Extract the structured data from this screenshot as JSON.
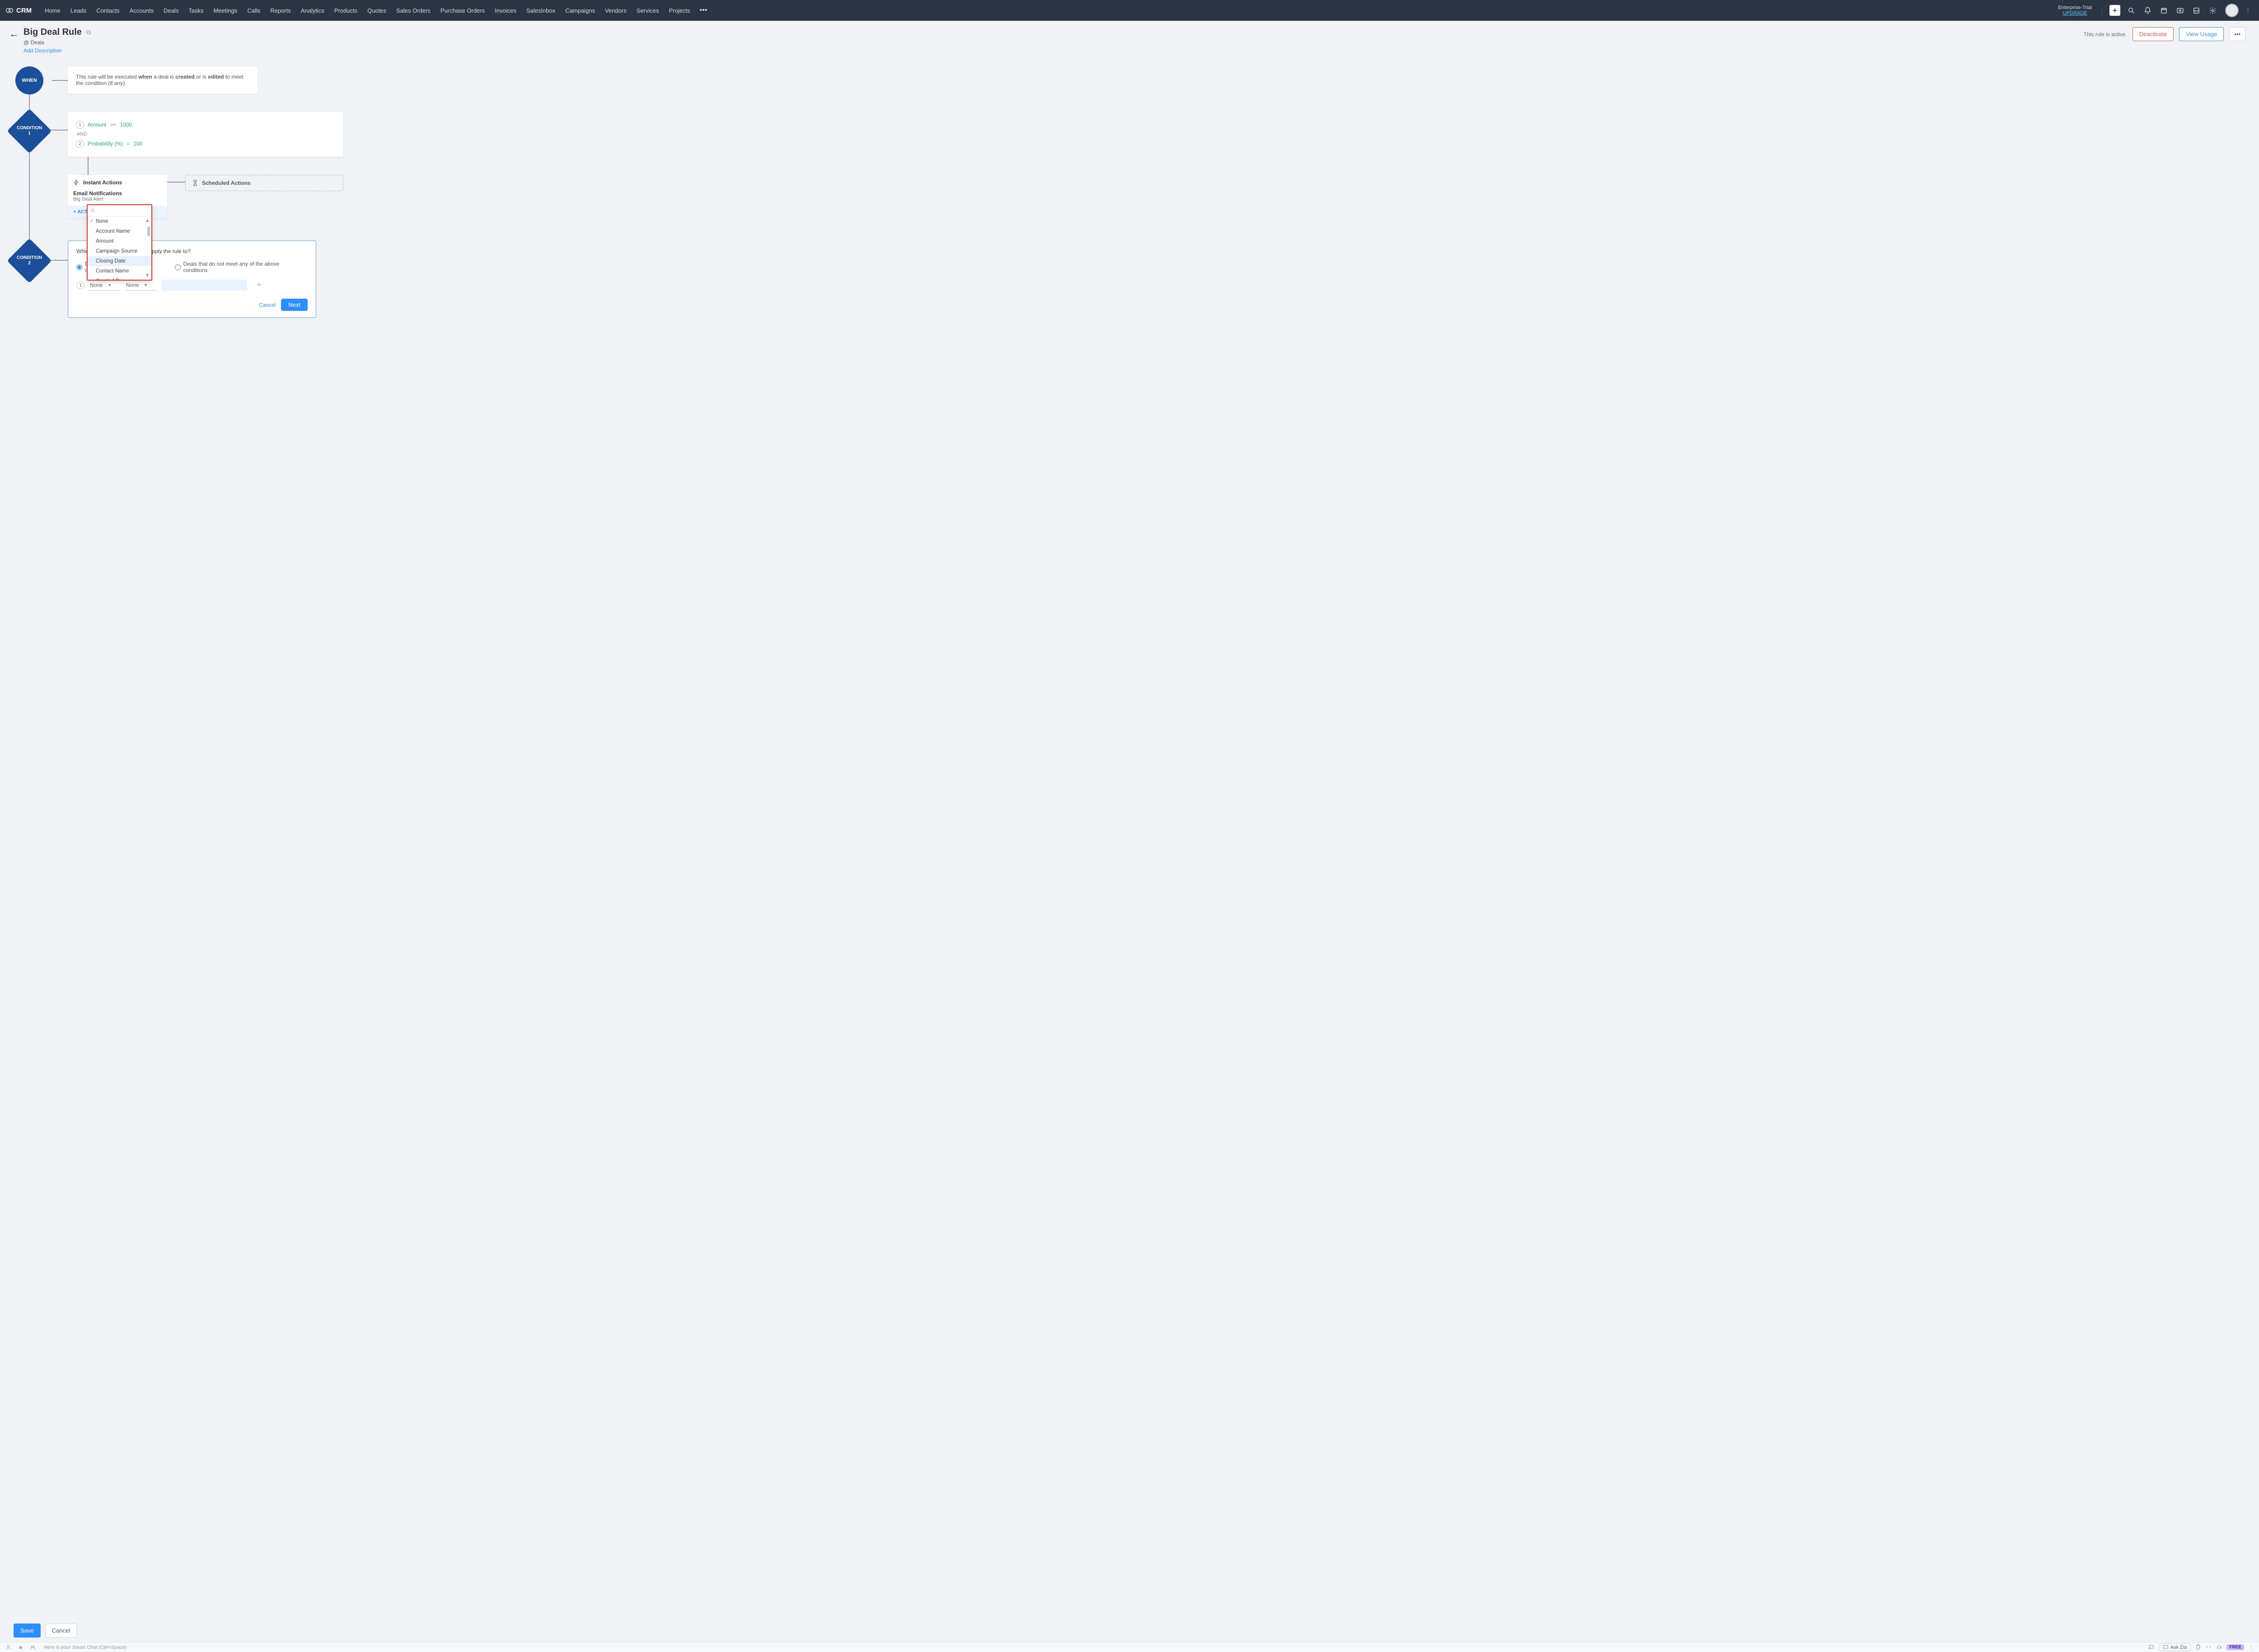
{
  "brand": "CRM",
  "nav": [
    "Home",
    "Leads",
    "Contacts",
    "Accounts",
    "Deals",
    "Tasks",
    "Meetings",
    "Calls",
    "Reports",
    "Analytics",
    "Products",
    "Quotes",
    "Sales Orders",
    "Purchase Orders",
    "Invoices",
    "SalesInbox",
    "Campaigns",
    "Vendors",
    "Services",
    "Projects"
  ],
  "trial": {
    "line1": "Enterprise-Trial",
    "upgrade": "UPGRADE"
  },
  "header": {
    "title": "Big Deal Rule",
    "module_prefix": "@",
    "module": "Deals",
    "add_desc": "Add Description",
    "status": "This rule is active.",
    "deactivate": "Deactivate",
    "view_usage": "View Usage",
    "more": "•••"
  },
  "when": {
    "node": "WHEN",
    "text_pre": "This rule will be executed ",
    "b1": "when",
    "mid1": " a deal is ",
    "b2": "created",
    "mid2": " or is ",
    "b3": "edited",
    "post": " to meet the condition (if any)."
  },
  "cond1": {
    "node_line1": "CONDITION",
    "node_line2": "1",
    "rows": [
      {
        "n": "1",
        "field": "Amount",
        "op": ">=",
        "val": "1000"
      },
      {
        "n": "2",
        "field": "Probability (%)",
        "op": "=",
        "val": "100"
      }
    ],
    "and": "AND"
  },
  "instant": {
    "title": "Instant Actions",
    "sub1": "Email Notifications",
    "sub2": "Big Deal Alert",
    "add": "+ ACTION"
  },
  "scheduled": {
    "title": "Scheduled Actions"
  },
  "cond2": {
    "node_line1": "CONDITION",
    "node_line2": "2",
    "question": "Which deals would you like to apply the rule to?",
    "r1": "Deals matching certain conditions",
    "r2": "Deals that do not meet any of the above conditions",
    "field_sel": "None",
    "op_sel": "None",
    "row_n": "1",
    "cancel": "Cancel",
    "next": "Next"
  },
  "dropdown": {
    "items": [
      "None",
      "Account Name",
      "Amount",
      "Campaign Source",
      "Closing Date",
      "Contact Name",
      "Created By"
    ],
    "selected": "None",
    "highlighted": "Closing Date"
  },
  "footer": {
    "save": "Save",
    "cancel": "Cancel"
  },
  "statusbar": {
    "hint": "Here is your Smart Chat (Ctrl+Space)",
    "ask": "Ask Zia",
    "free": "FREE"
  }
}
